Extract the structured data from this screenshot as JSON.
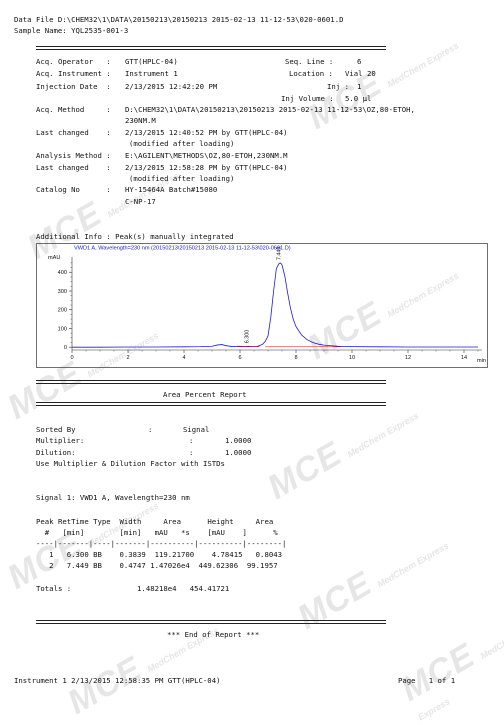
{
  "header": {
    "data_file": "Data File D:\\CHEM32\\1\\DATA\\20150213\\20150213 2015-02-13 11-12-53\\020-0601.D",
    "sample_name": "Sample Name: YQL2535-001-3"
  },
  "info": {
    "acq_operator_label": "Acq. Operator   :",
    "acq_operator": "GTT(HPLC-04)",
    "seq_line_label": "Seq. Line :",
    "seq_line": "6",
    "acq_instrument_label": "Acq. Instrument :",
    "acq_instrument": "Instrument 1",
    "location_label": "Location :",
    "location": "Vial 20",
    "injection_date_label": "Injection Date  :",
    "injection_date": "2/13/2015 12:42:20 PM",
    "inj_label": "Inj :",
    "inj": "1",
    "inj_volume_label": "Inj Volume :",
    "inj_volume": "5.0 µl",
    "acq_method_label": "Acq. Method     :",
    "acq_method_1": "D:\\CHEM32\\1\\DATA\\20150213\\20150213 2015-02-13 11-12-53\\OZ,80-ETOH,",
    "acq_method_2": "230NM.M",
    "last_changed_label": "Last changed    :",
    "last_changed_1": "2/13/2015 12:40:52 PM by GTT(HPLC-04)",
    "last_changed_1_note": "(modified after loading)",
    "analysis_method_label": "Analysis Method :",
    "analysis_method": "E:\\AGILENT\\METHODS\\OZ,80-ETOH,230NM.M",
    "last_changed_2": "2/13/2015 12:58:28 PM by GTT(HPLC-04)",
    "last_changed_2_note": "(modified after loading)",
    "catalog_label": "Catalog No      :",
    "catalog_1": "HY-15464A Batch#15080",
    "catalog_2": "C-NP-17",
    "additional_info": "Additional Info : Peak(s) manually integrated"
  },
  "chart_data": {
    "type": "line",
    "title": "VWD1 A, Wavelength=230 nm (20150213\\20150213 2015-02-13 11-12-53\\020-0601.D)",
    "ylabel": "mAU",
    "xlabel": "min",
    "xlim": [
      0,
      14.5
    ],
    "ylim": [
      -15,
      460
    ],
    "x_ticks": [
      0,
      2,
      4,
      6,
      8,
      10,
      12,
      14
    ],
    "y_ticks": [
      0,
      100,
      200,
      300,
      400
    ],
    "peak_labels": [
      {
        "rt": 6.3,
        "label": "6.300"
      },
      {
        "rt": 7.449,
        "label": "7.449"
      }
    ],
    "series": [
      {
        "color": "#1a1ad6",
        "x": [
          0,
          0.5,
          1.0,
          2.0,
          3.0,
          4.0,
          4.6,
          5.0,
          5.2,
          5.35,
          5.5,
          5.7,
          6.0,
          6.2,
          6.3,
          6.4,
          6.6,
          6.8,
          6.9,
          7.0,
          7.1,
          7.2,
          7.3,
          7.4,
          7.45,
          7.5,
          7.6,
          7.7,
          7.8,
          7.9,
          8.0,
          8.2,
          8.4,
          8.6,
          8.8,
          9.0,
          9.5,
          10.0,
          11.0,
          12.0,
          13.0,
          14.0,
          14.5
        ],
        "y": [
          0,
          0,
          0,
          1,
          1,
          2,
          3,
          5,
          12,
          14,
          8,
          4,
          5,
          3,
          5,
          3,
          3,
          15,
          30,
          60,
          160,
          300,
          420,
          448,
          449,
          440,
          380,
          290,
          210,
          150,
          110,
          65,
          40,
          25,
          16,
          11,
          5,
          3,
          2,
          1,
          1,
          1,
          1
        ]
      }
    ]
  },
  "report": {
    "title": "Area Percent Report",
    "sorted_by_label": "Sorted By",
    "sorted_by": "Signal",
    "multiplier_label": "Multiplier:",
    "multiplier": "1.0000",
    "dilution_label": "Dilution:",
    "dilution": "1.0000",
    "istd_note": "Use Multiplier & Dilution Factor with ISTDs",
    "signal_line": "Signal 1: VWD1 A, Wavelength=230 nm",
    "table_head_1": "Peak RetTime Type  Width     Area      Height     Area",
    "table_head_2": "  #   [min]        [min]   mAU   *s    [mAU    ]      %",
    "table_sep": "----|-------|----|-------|----------|----------|--------|",
    "rows": [
      "   1   6.300 BB    0.3839  119.21700    4.78415   0.8043",
      "   2   7.449 BB    0.4747 1.47026e4  449.62306  99.1957"
    ],
    "totals": "Totals :               1.48218e4   454.41721",
    "end": "*** End of Report ***"
  },
  "footer": {
    "left": "Instrument 1 2/13/2015 12:58:35 PM GTT(HPLC-04)",
    "right": "Page   1 of 1"
  },
  "watermark": {
    "brand": "MCE",
    "tagline": "MedChem Express",
    "reg": "®"
  }
}
